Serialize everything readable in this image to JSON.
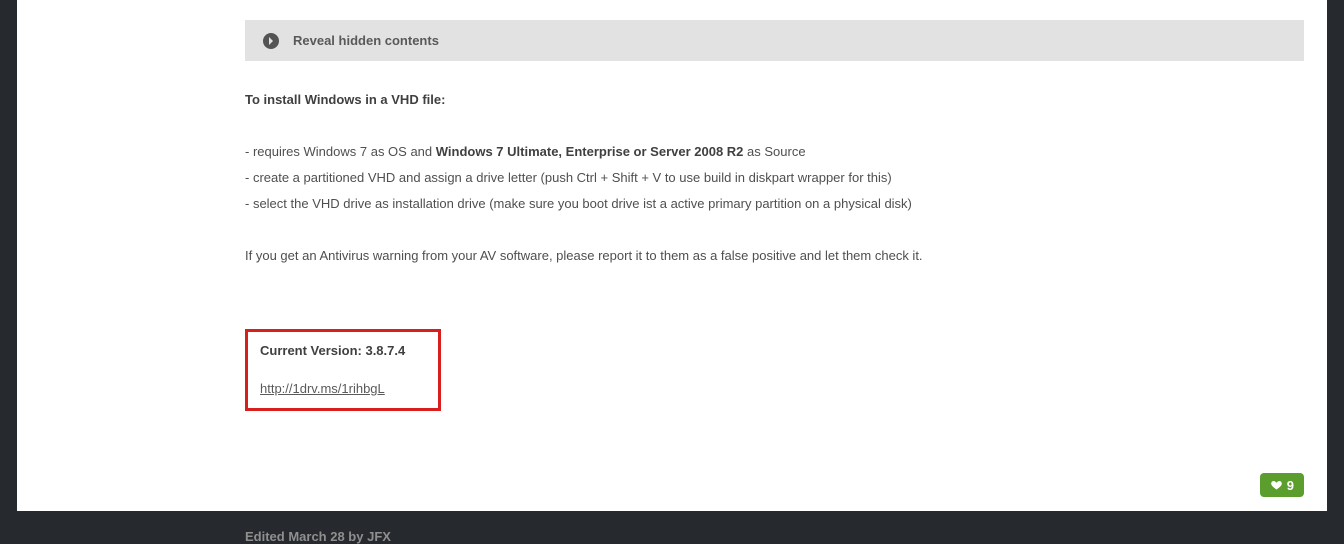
{
  "spoiler": {
    "label": "Reveal hidden contents"
  },
  "post": {
    "install_heading": "To install Windows in a VHD file:",
    "line1_a": "- requires Windows 7 as OS and ",
    "line1_b": "Windows 7 Ultimate, Enterprise or Server 2008 R2",
    "line1_c": " as Source",
    "line2": "- create a partitioned VHD and assign a drive letter (push Ctrl + Shift + V to use build in diskpart wrapper for this)",
    "line3": "- select the VHD drive as installation drive (make sure you boot drive ist a active primary partition on a physical disk)",
    "av_note": "If you get an Antivirus warning from your AV software, please report it to them as a false positive and let them check it.",
    "current_version": "Current Version: 3.8.7.4",
    "download_url": "http://1drv.ms/1rihbgL",
    "edited": "Edited March 28 by JFX"
  },
  "reactions": {
    "count": "9"
  }
}
